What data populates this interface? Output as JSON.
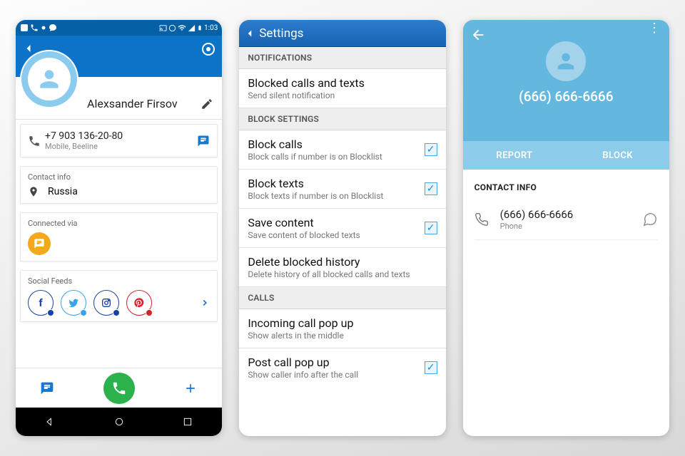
{
  "phone1": {
    "status_time": "1:03",
    "contact_name": "Alexsander Firsov",
    "phone_number": "+7 903 136-20-80",
    "phone_sub": "Mobile, Beeline",
    "section_contact": "Contact info",
    "location": "Russia",
    "section_connected": "Connected via",
    "section_social": "Social Feeds"
  },
  "phone2": {
    "title": "Settings",
    "sec_notifications": "NOTIFICATIONS",
    "item1_title": "Blocked calls and texts",
    "item1_sub": "Send silent notification",
    "sec_block": "BLOCK SETTINGS",
    "item2_title": "Block calls",
    "item2_sub": "Block calls if number is on Blocklist",
    "item3_title": "Block texts",
    "item3_sub": "Block texts if number is on Blocklist",
    "item4_title": "Save content",
    "item4_sub": "Save content of blocked texts",
    "item5_title": "Delete blocked history",
    "item5_sub": "Delete history of all blocked calls and texts",
    "sec_calls": "CALLS",
    "item6_title": "Incoming call pop up",
    "item6_sub": "Show alerts in the middle",
    "item7_title": "Post call pop up",
    "item7_sub": "Show caller info after the call"
  },
  "phone3": {
    "header_number": "(666) 666-6666",
    "tab_report": "REPORT",
    "tab_block": "BLOCK",
    "contact_info_label": "CONTACT INFO",
    "row_number": "(666) 666-6666",
    "row_sub": "Phone"
  }
}
